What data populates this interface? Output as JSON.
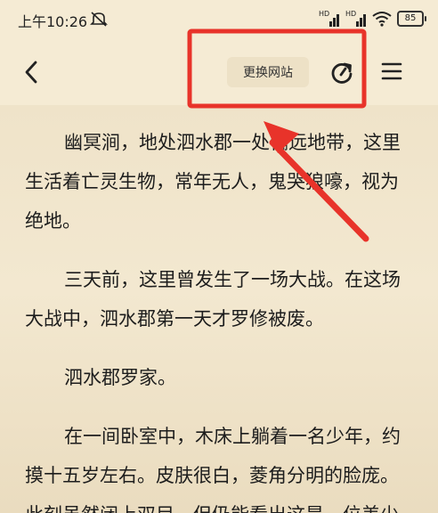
{
  "status_bar": {
    "time": "上午10:26",
    "signal_label_1": "HD",
    "signal_label_2": "HD",
    "battery": "85",
    "icons": [
      "mute-icon",
      "signal-icon",
      "signal-icon",
      "wifi-icon",
      "battery-icon"
    ]
  },
  "toolbar": {
    "back_icon": "chevron-left-icon",
    "switch_site_label": "更换网站",
    "refresh_icon": "refresh-icon",
    "menu_icon": "menu-icon"
  },
  "reader": {
    "paragraphs": [
      "幽冥涧，地处泗水郡一处偏远地带，这里生活着亡灵生物，常年无人，鬼哭狼嚎，视为绝地。",
      "三天前，这里曾发生了一场大战。在这场大战中，泗水郡第一天才罗修被废。",
      "泗水郡罗家。",
      "在一间卧室中，木床上躺着一名少年，约摸十五岁左右。皮肤很白，菱角分明的脸庞。此刻虽然闭上双目，但仍能看出这是一位美少"
    ]
  },
  "annotation": {
    "color": "#e8332a"
  }
}
